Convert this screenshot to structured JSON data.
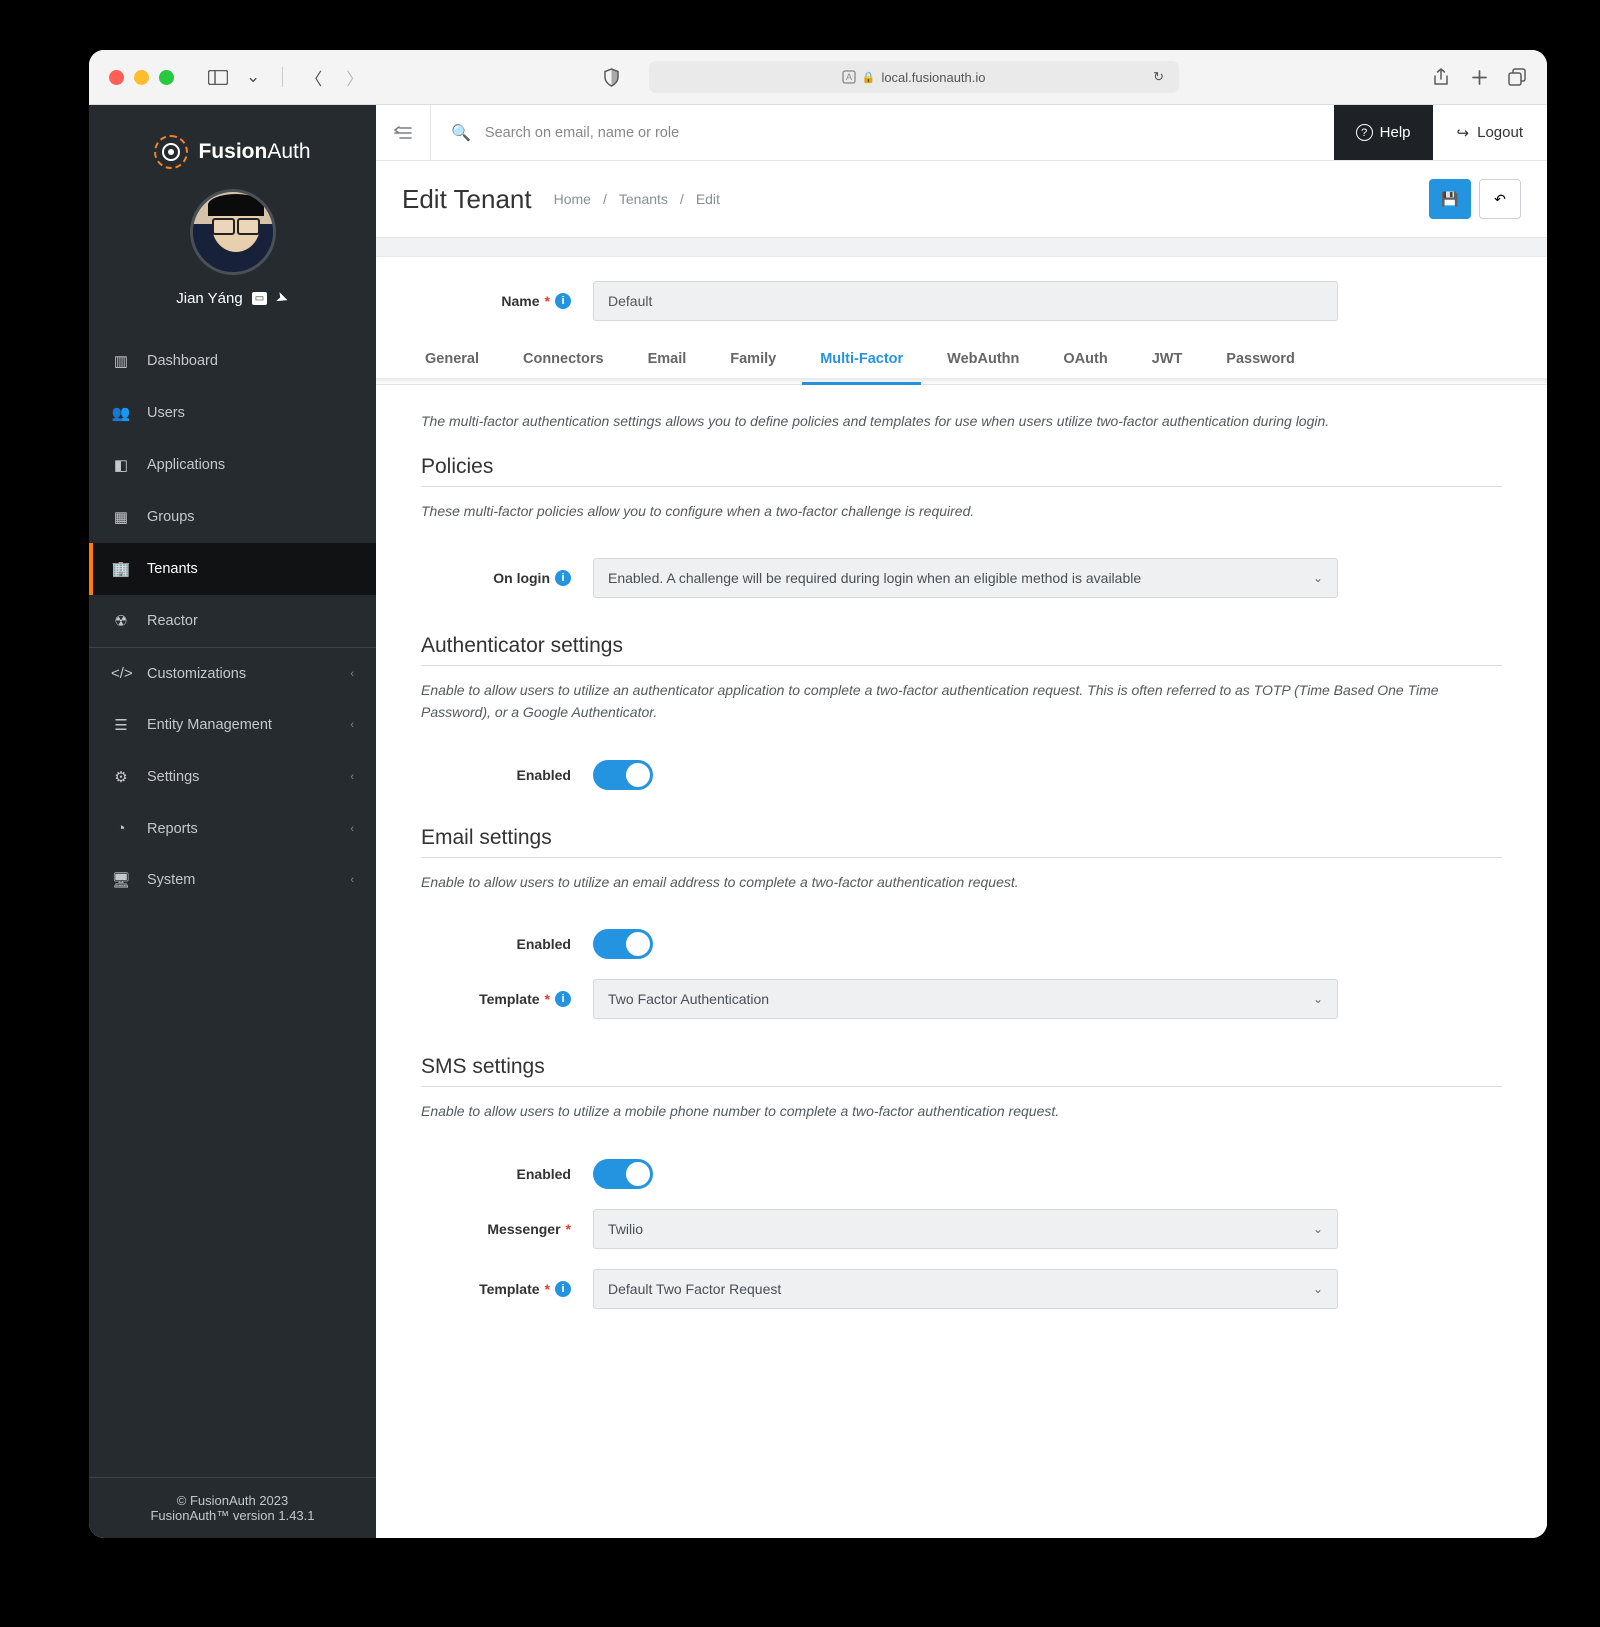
{
  "browser": {
    "url": "local.fusionauth.io"
  },
  "brand": {
    "name_a": "Fusion",
    "name_b": "Auth"
  },
  "user": {
    "name": "Jian Yáng"
  },
  "sidebar": {
    "items": [
      {
        "label": "Dashboard",
        "icon": "dashboard"
      },
      {
        "label": "Users",
        "icon": "users"
      },
      {
        "label": "Applications",
        "icon": "apps"
      },
      {
        "label": "Groups",
        "icon": "groups"
      },
      {
        "label": "Tenants",
        "icon": "tenants",
        "active": true
      },
      {
        "label": "Reactor",
        "icon": "reactor"
      }
    ],
    "items2": [
      {
        "label": "Customizations",
        "icon": "code"
      },
      {
        "label": "Entity Management",
        "icon": "entity"
      },
      {
        "label": "Settings",
        "icon": "settings"
      },
      {
        "label": "Reports",
        "icon": "reports"
      },
      {
        "label": "System",
        "icon": "system"
      }
    ],
    "footer": {
      "copyright": "© FusionAuth 2023",
      "version": "FusionAuth™ version 1.43.1"
    }
  },
  "topbar": {
    "search_placeholder": "Search on email, name or role",
    "help": "Help",
    "logout": "Logout"
  },
  "page": {
    "title": "Edit Tenant",
    "crumbs": [
      "Home",
      "Tenants",
      "Edit"
    ]
  },
  "form": {
    "name_label": "Name",
    "name_value": "Default"
  },
  "tabs": [
    "General",
    "Connectors",
    "Email",
    "Family",
    "Multi-Factor",
    "WebAuthn",
    "OAuth",
    "JWT",
    "Password"
  ],
  "active_tab": "Multi-Factor",
  "mfa": {
    "intro": "The multi-factor authentication settings allows you to define policies and templates for use when users utilize two-factor authentication during login.",
    "policies": {
      "heading": "Policies",
      "desc": "These multi-factor policies allow you to configure when a two-factor challenge is required.",
      "on_login_label": "On login",
      "on_login_value": "Enabled. A challenge will be required during login when an eligible method is available"
    },
    "authenticator": {
      "heading": "Authenticator settings",
      "desc": "Enable to allow users to utilize an authenticator application to complete a two-factor authentication request. This is often referred to as TOTP (Time Based One Time Password), or a Google Authenticator.",
      "enabled_label": "Enabled"
    },
    "email": {
      "heading": "Email settings",
      "desc": "Enable to allow users to utilize an email address to complete a two-factor authentication request.",
      "enabled_label": "Enabled",
      "template_label": "Template",
      "template_value": "Two Factor Authentication"
    },
    "sms": {
      "heading": "SMS settings",
      "desc": "Enable to allow users to utilize a mobile phone number to complete a two-factor authentication request.",
      "enabled_label": "Enabled",
      "messenger_label": "Messenger",
      "messenger_value": "Twilio",
      "template_label": "Template",
      "template_value": "Default Two Factor Request"
    }
  }
}
